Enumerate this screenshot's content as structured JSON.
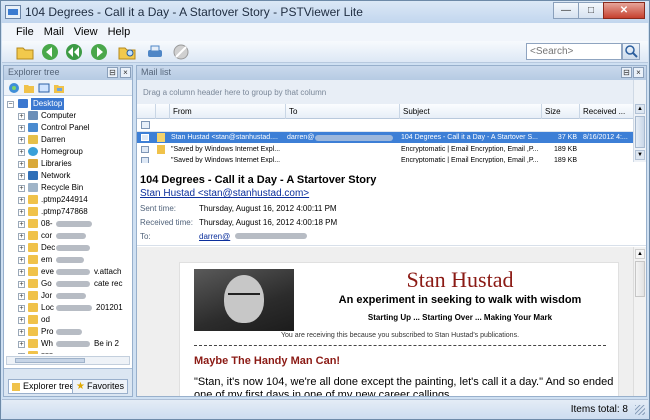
{
  "window": {
    "title": "104 Degrees - Call it a Day - A Startover Story - PSTViewer Lite"
  },
  "menu": {
    "items": [
      "File",
      "Mail",
      "View",
      "Help"
    ]
  },
  "toolbar": {
    "buttons": [
      "open-folder-icon",
      "back-icon",
      "reply-all-icon",
      "forward-icon",
      "folder-search-icon",
      "print-icon",
      "cancel-icon"
    ],
    "search_placeholder": "<Search>"
  },
  "explorer": {
    "header": "Explorer tree",
    "tree": [
      {
        "label": "Desktop",
        "selected": true
      },
      {
        "label": "Computer"
      },
      {
        "label": "Control Panel"
      },
      {
        "label": "Darren"
      },
      {
        "label": "Homegroup"
      },
      {
        "label": "Libraries"
      },
      {
        "label": "Network"
      },
      {
        "label": "Recycle Bin"
      },
      {
        "label": ".ptmp244914"
      },
      {
        "label": ".ptmp747868"
      },
      {
        "label": "08-"
      },
      {
        "label": "cor"
      },
      {
        "label": "Dec"
      },
      {
        "label": "em"
      },
      {
        "label": "eve",
        "tail": "v.attach"
      },
      {
        "label": "Go",
        "tail": "cate rec"
      },
      {
        "label": "Jor"
      },
      {
        "label": "Loc",
        "tail": "201201"
      },
      {
        "label": "od"
      },
      {
        "label": "Pro"
      },
      {
        "label": "Wh",
        "tail": "Be in 2"
      },
      {
        "label": "zzz"
      }
    ],
    "tabs": [
      "Explorer tree",
      "Favorites"
    ]
  },
  "mail_list": {
    "header": "Mail list",
    "group_hint": "Drag a column header here to group by that column",
    "columns": [
      "From",
      "To",
      "Subject",
      "Size",
      "Received ..."
    ],
    "rows": [
      {
        "from": "Stan Hustad <stan@stanhustad....",
        "to": "darren@",
        "subject": "104 Degrees - Call it a Day - A Startover S...",
        "size": "37 KB",
        "received": "8/16/2012 4:..."
      },
      {
        "from": "\"Saved by Windows Internet Expl...",
        "to": "",
        "subject": "Encryptomatic | Email Encryption, Email ,P...",
        "size": "189 KB",
        "received": ""
      },
      {
        "from": "\"Saved by Windows Internet Expl...",
        "to": "",
        "subject": "Encryptomatic | Email Encryption, Email ,P...",
        "size": "189 KB",
        "received": ""
      }
    ]
  },
  "message": {
    "subject": "104 Degrees - Call it a Day - A Startover Story",
    "from": "Stan Hustad <stan@stanhustad.com>",
    "sent_label": "Sent time:",
    "sent_value": "Thursday, August 16, 2012 4:00:11 PM",
    "received_label": "Received time:",
    "received_value": "Thursday, August 16, 2012 4:00:18 PM",
    "to_label": "To:",
    "to_value": "darren@"
  },
  "newsletter": {
    "title": "Stan Hustad",
    "tagline": "An experiment in seeking to walk with wisdom",
    "subtitle": "Starting Up ... Starting Over ... Making Your Mark",
    "note": "You are receiving this because you subscribed to Stan Hustad's publications.",
    "heading": "Maybe The Handy Man Can!",
    "paragraph": "\"Stan, it's now 104, we're all done except the painting, let's call it a day.\"  And so ended one of my first days in one of my new career callings"
  },
  "status": {
    "items_total": "Items total: 8"
  }
}
